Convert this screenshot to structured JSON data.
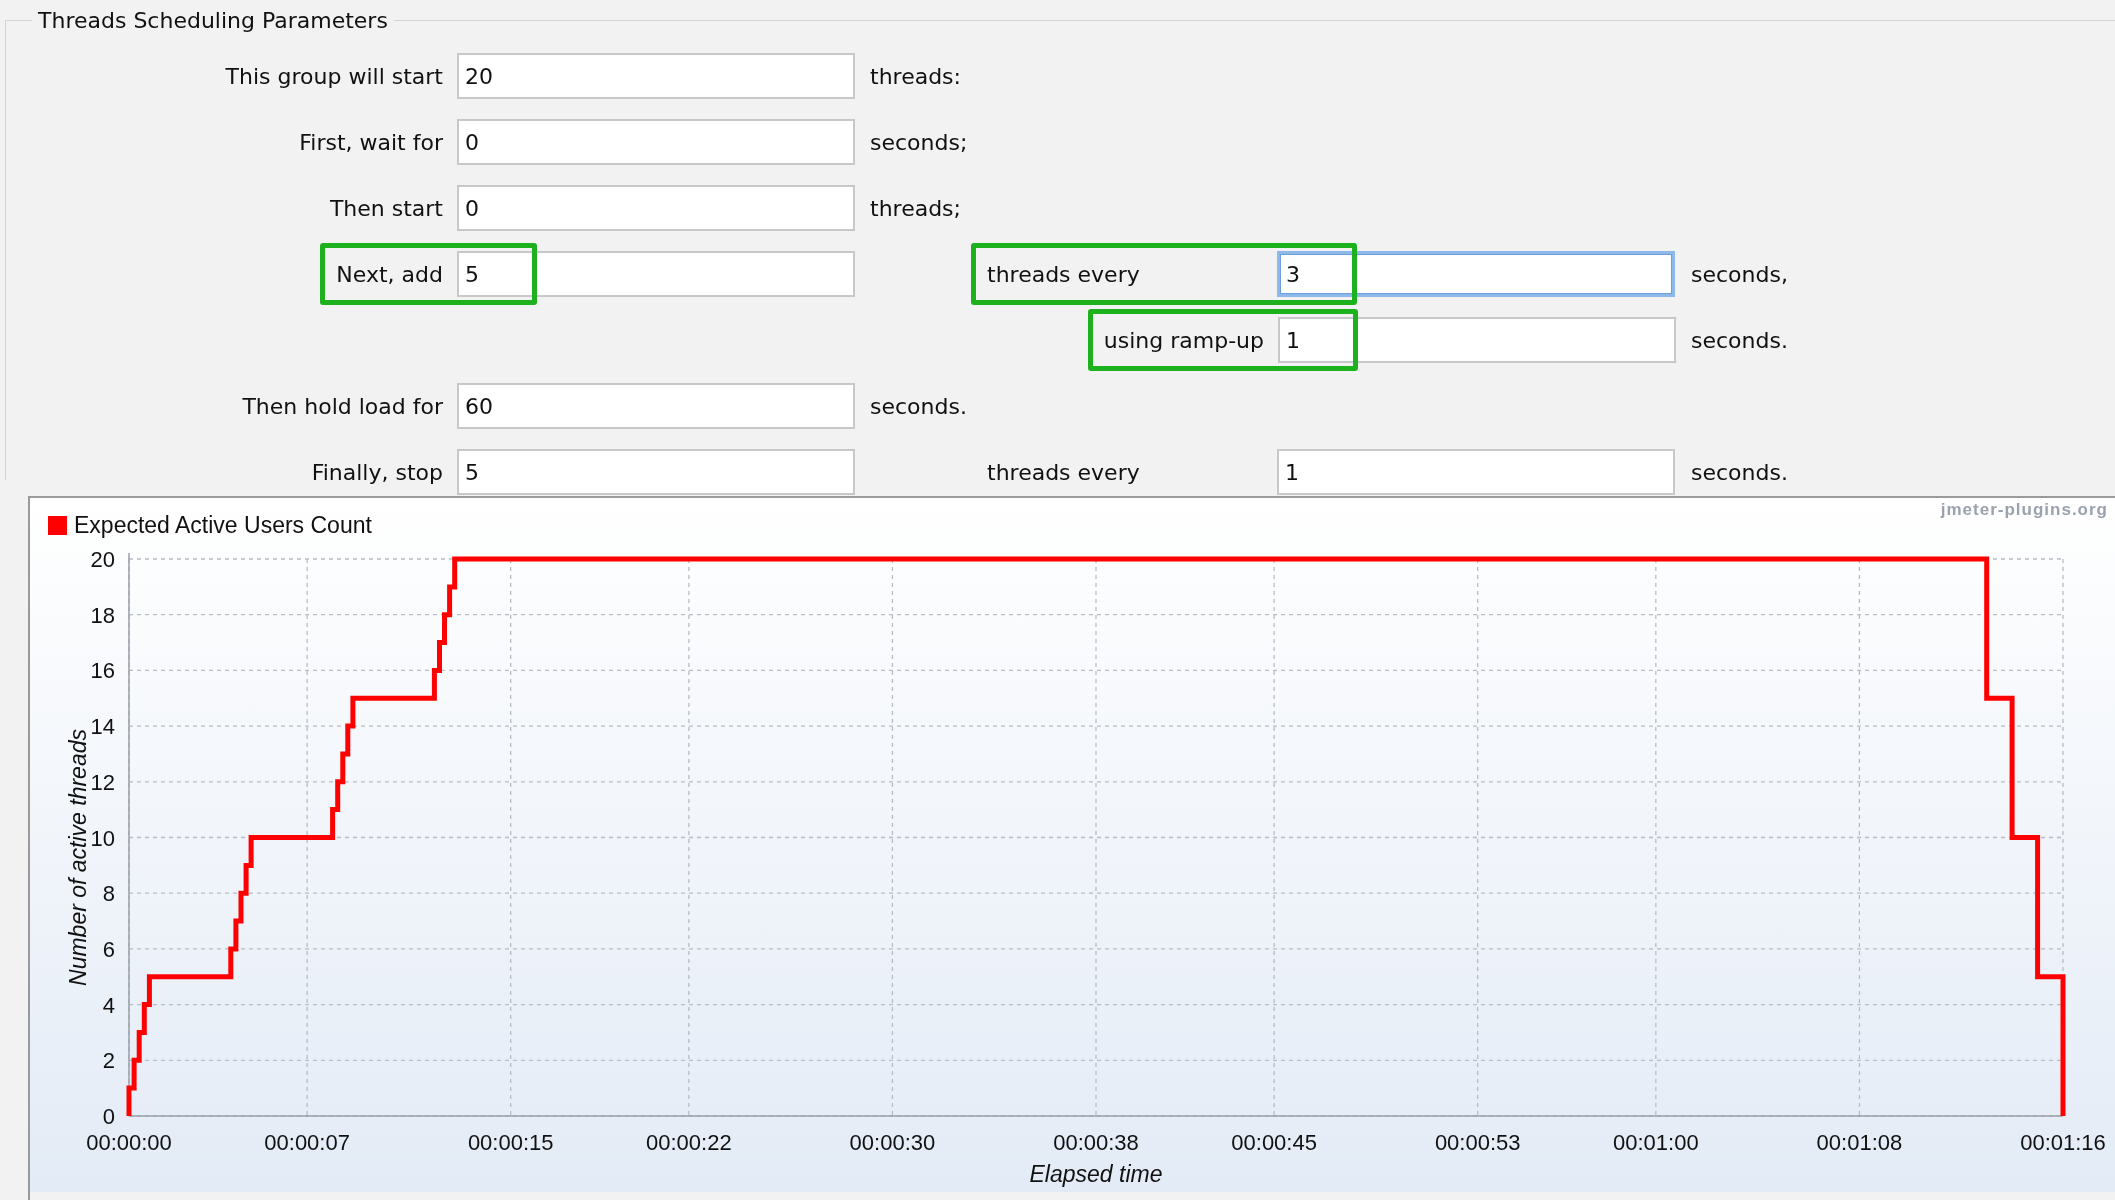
{
  "group": {
    "title": "Threads Scheduling Parameters"
  },
  "rows": [
    {
      "kind": "single",
      "label": "This group will start",
      "value": "20",
      "unit": "threads:",
      "highlighted": false
    },
    {
      "kind": "single",
      "label": "First, wait for",
      "value": "0",
      "unit": "seconds;",
      "highlighted": false
    },
    {
      "kind": "single",
      "label": "Then start",
      "value": "0",
      "unit": "threads;",
      "highlighted": false
    },
    {
      "kind": "step",
      "label": "Next, add",
      "value": "5",
      "highlighted": true,
      "second": {
        "label": "threads every",
        "value": "3",
        "unit": "seconds,",
        "focused": true,
        "highlighted": true
      }
    },
    {
      "kind": "ramp-up",
      "second": {
        "label": "using ramp-up",
        "value": "1",
        "unit": "seconds.",
        "focused": false,
        "highlighted": true
      }
    },
    {
      "kind": "single",
      "label": "Then hold load for",
      "value": "60",
      "unit": "seconds.",
      "highlighted": false
    },
    {
      "kind": "step",
      "label": "Finally, stop",
      "value": "5",
      "highlighted": false,
      "second": {
        "label": "threads every",
        "value": "1",
        "unit": "seconds.",
        "focused": false,
        "highlighted": false
      }
    }
  ],
  "chart": {
    "watermark": "jmeter-plugins.org",
    "chart_data": {
      "type": "line",
      "grid": true,
      "xlabel": "Elapsed time",
      "ylabel": "Number of active threads",
      "xlim": [
        0,
        76
      ],
      "ylim": [
        0,
        20
      ],
      "yticks": [
        0,
        2,
        4,
        6,
        8,
        10,
        12,
        14,
        16,
        18,
        20
      ],
      "xticks": [
        {
          "value": 0,
          "label": "00:00:00"
        },
        {
          "value": 7,
          "label": "00:00:07"
        },
        {
          "value": 15,
          "label": "00:00:15"
        },
        {
          "value": 22,
          "label": "00:00:22"
        },
        {
          "value": 30,
          "label": "00:00:30"
        },
        {
          "value": 38,
          "label": "00:00:38"
        },
        {
          "value": 45,
          "label": "00:00:45"
        },
        {
          "value": 53,
          "label": "00:00:53"
        },
        {
          "value": 60,
          "label": "00:01:00"
        },
        {
          "value": 68,
          "label": "00:01:08"
        },
        {
          "value": 76,
          "label": "00:01:16"
        }
      ],
      "x": [
        0,
        0,
        0.2,
        0.2,
        0.4,
        0.4,
        0.6,
        0.6,
        0.8,
        0.8,
        4,
        4,
        4.2,
        4.2,
        4.4,
        4.4,
        4.6,
        4.6,
        4.8,
        4.8,
        8,
        8,
        8.2,
        8.2,
        8.4,
        8.4,
        8.6,
        8.6,
        8.8,
        8.8,
        12,
        12,
        12.2,
        12.2,
        12.4,
        12.4,
        12.6,
        12.6,
        12.8,
        12.8,
        73,
        73,
        74,
        74,
        75,
        75,
        76,
        76
      ],
      "series": [
        {
          "name": "Expected Active Users Count",
          "color": "#ff0000",
          "values": [
            0,
            1,
            1,
            2,
            2,
            3,
            3,
            4,
            4,
            5,
            5,
            6,
            6,
            7,
            7,
            8,
            8,
            9,
            9,
            10,
            10,
            11,
            11,
            12,
            12,
            13,
            13,
            14,
            14,
            15,
            15,
            16,
            16,
            17,
            17,
            18,
            18,
            19,
            19,
            20,
            20,
            15,
            15,
            10,
            10,
            5,
            5,
            0
          ]
        }
      ]
    }
  }
}
